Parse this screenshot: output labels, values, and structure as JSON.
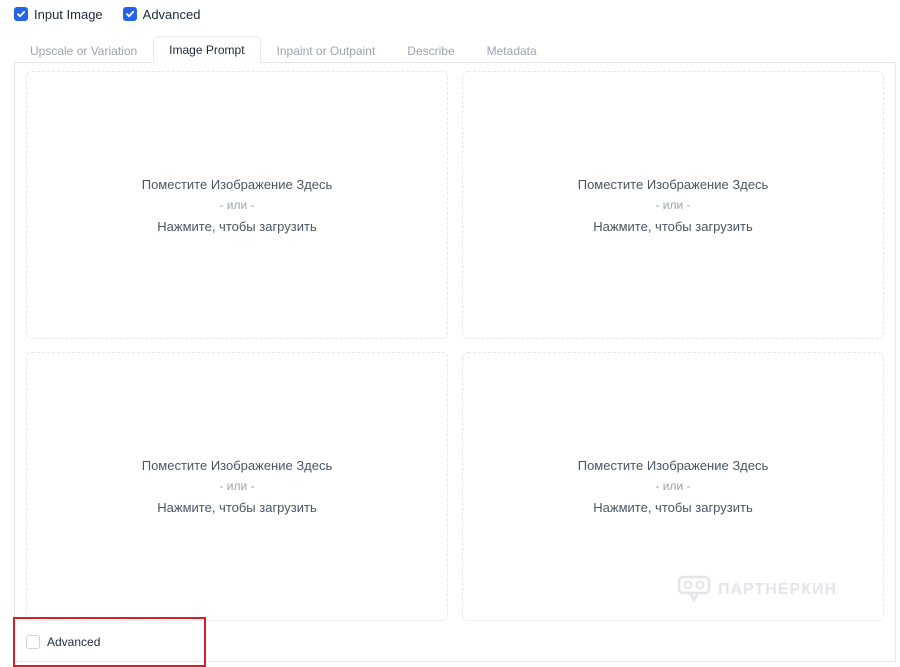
{
  "top_options": [
    {
      "label": "Input Image",
      "checked": true
    },
    {
      "label": "Advanced",
      "checked": true
    }
  ],
  "tabs": [
    {
      "label": "Upscale or Variation",
      "active": false
    },
    {
      "label": "Image Prompt",
      "active": true
    },
    {
      "label": "Inpaint or Outpaint",
      "active": false
    },
    {
      "label": "Describe",
      "active": false
    },
    {
      "label": "Metadata",
      "active": false
    }
  ],
  "dropzones": [
    {
      "drop_text": "Поместите Изображение Здесь",
      "or_text": "- или -",
      "click_text": "Нажмите, чтобы загрузить"
    },
    {
      "drop_text": "Поместите Изображение Здесь",
      "or_text": "- или -",
      "click_text": "Нажмите, чтобы загрузить"
    },
    {
      "drop_text": "Поместите Изображение Здесь",
      "or_text": "- или -",
      "click_text": "Нажмите, чтобы загрузить"
    },
    {
      "drop_text": "Поместите Изображение Здесь",
      "or_text": "- или -",
      "click_text": "Нажмите, чтобы загрузить"
    }
  ],
  "bottom_option": {
    "label": "Advanced",
    "checked": false
  },
  "watermark": {
    "text": "ПАРТНЕРКИН",
    "icon": "vr-headset-icon"
  },
  "colors": {
    "accent": "#2563eb",
    "highlight": "#d61f26"
  }
}
